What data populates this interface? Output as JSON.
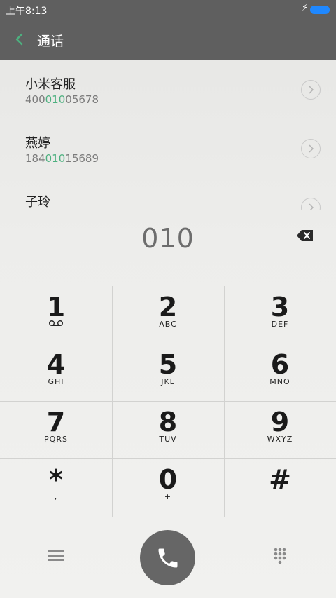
{
  "status_bar": {
    "time": "上午8:13",
    "charging_icon": "bolt-icon",
    "battery_color": "#1f88ff"
  },
  "header": {
    "title": "通话",
    "back_icon": "chevron-left-icon",
    "accent": "#4db07f"
  },
  "contacts": [
    {
      "name": "小米客服",
      "number_pre": "400",
      "number_match": "010",
      "number_post": "05678"
    },
    {
      "name": "燕婷",
      "number_pre": "184",
      "number_match": "010",
      "number_post": "15689"
    },
    {
      "name": "子玲",
      "number_pre": "",
      "number_match": "",
      "number_post": ""
    }
  ],
  "dialed_number": "010",
  "keys": [
    {
      "digit": "1",
      "letters": ""
    },
    {
      "digit": "2",
      "letters": "ABC"
    },
    {
      "digit": "3",
      "letters": "DEF"
    },
    {
      "digit": "4",
      "letters": "GHI"
    },
    {
      "digit": "5",
      "letters": "JKL"
    },
    {
      "digit": "6",
      "letters": "MNO"
    },
    {
      "digit": "7",
      "letters": "PQRS"
    },
    {
      "digit": "8",
      "letters": "TUV"
    },
    {
      "digit": "9",
      "letters": "WXYZ"
    },
    {
      "digit": "*",
      "letters": ","
    },
    {
      "digit": "0",
      "letters": "+"
    },
    {
      "digit": "#",
      "letters": ""
    }
  ],
  "bottom_bar": {
    "menu_icon": "hamburger-menu-icon",
    "call_icon": "phone-icon",
    "dialpad_icon": "dialpad-icon"
  }
}
